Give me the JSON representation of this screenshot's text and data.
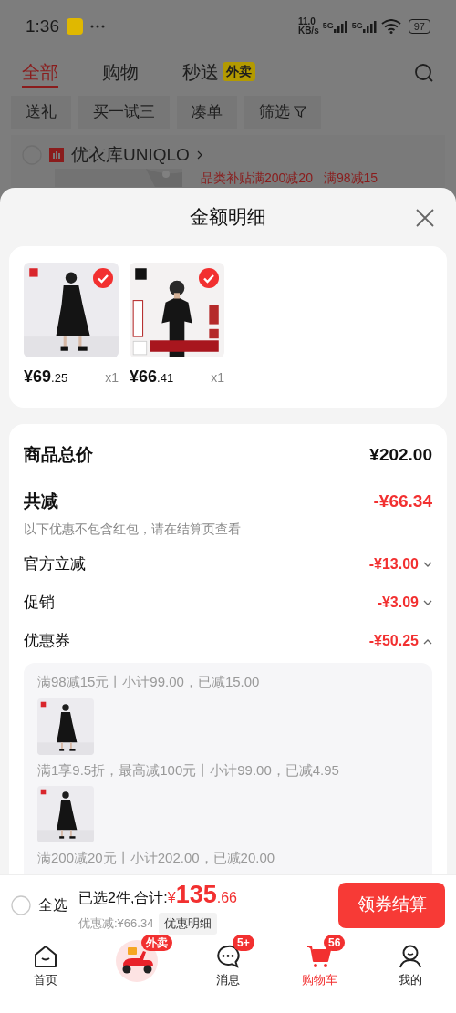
{
  "status_bar": {
    "time": "1:36",
    "net_speed": "11.0",
    "net_unit": "KB/s",
    "signals": [
      "5G",
      "5G"
    ],
    "battery": "97"
  },
  "top_tabs": [
    {
      "label": "全部",
      "selected": true
    },
    {
      "label": "购物",
      "selected": false
    },
    {
      "label": "秒送",
      "selected": false,
      "badge": "外卖"
    }
  ],
  "filter_chips": [
    {
      "label": "送礼",
      "kind": "plain"
    },
    {
      "label": "买一试三",
      "kind": "plain"
    },
    {
      "label": "凑单",
      "kind": "plain"
    },
    {
      "label": "筛选",
      "kind": "filter"
    }
  ],
  "store": {
    "name": "优衣库UNIQLO",
    "checked": false,
    "promos": [
      "品类补贴满200减20",
      "满98减15"
    ]
  },
  "sheet": {
    "title": "金额明细",
    "items": [
      {
        "kind": "dress",
        "price": "¥69",
        "price_decimals": ".25",
        "quantity": "x1",
        "selected": true
      },
      {
        "kind": "tshirt",
        "price": "¥66",
        "price_decimals": ".41",
        "quantity": "x1",
        "selected": true
      }
    ],
    "total": {
      "label": "商品总价",
      "value": "¥202.00"
    },
    "reduction": {
      "label": "共减",
      "value": "-¥66.34",
      "note": "以下优惠不包含红包，请在结算页查看"
    },
    "discounts": [
      {
        "label": "官方立减",
        "value": "-¥13.00",
        "expanded": false
      },
      {
        "label": "促销",
        "value": "-¥3.09",
        "expanded": false
      },
      {
        "label": "优惠券",
        "value": "-¥50.25",
        "expanded": true
      }
    ],
    "coupon_details": [
      {
        "rule": "满98减15元丨小计99.00，已减15.00"
      },
      {
        "rule": "满1享9.5折，最高减100元丨小计99.00，已减4.95"
      },
      {
        "rule": "满200减20元丨小计202.00，已减20.00"
      }
    ]
  },
  "checkout_bar": {
    "select_all": {
      "label": "全选",
      "checked": false
    },
    "summary": "已选2件,合计:",
    "currency": "¥",
    "amount": "135",
    "amount_decimals": ".66",
    "discount": "优惠减:¥66.34",
    "detail_button": "优惠明细",
    "checkout_button": "领券结算"
  },
  "bottom_nav": [
    {
      "kind": "home",
      "label": "首页",
      "selected": false
    },
    {
      "kind": "delivery",
      "badge": "外卖",
      "selected": false
    },
    {
      "kind": "chat",
      "label": "消息",
      "badge": "5+",
      "selected": false
    },
    {
      "kind": "cart",
      "label": "购物车",
      "badge": "56",
      "selected": true
    },
    {
      "kind": "profile",
      "label": "我的",
      "selected": false
    }
  ]
}
